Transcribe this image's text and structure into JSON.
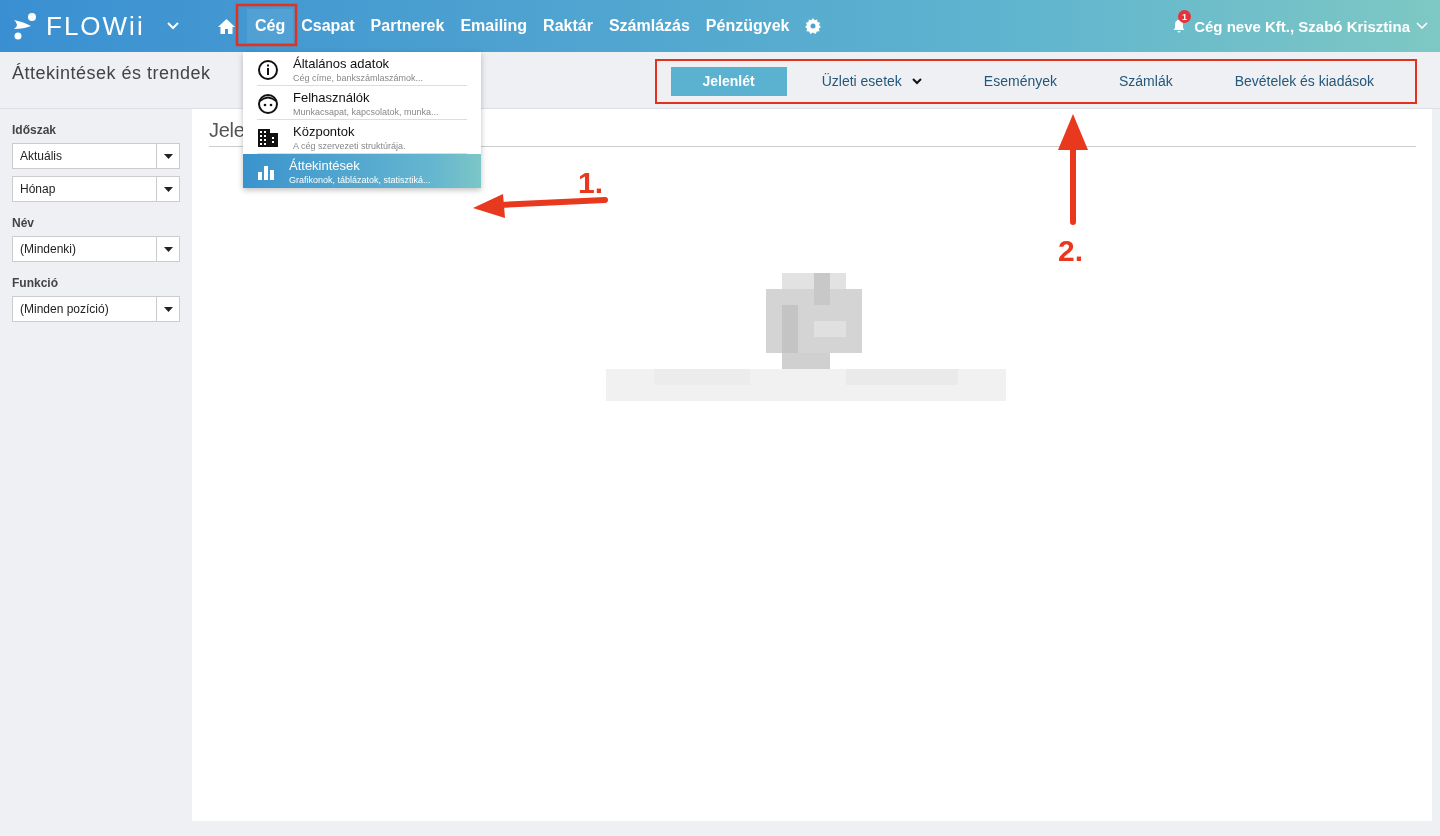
{
  "topbar": {
    "logo": "FLOWii",
    "nav": [
      {
        "label": "Cég",
        "selected": true
      },
      {
        "label": "Csapat",
        "selected": false
      },
      {
        "label": "Partnerek",
        "selected": false
      },
      {
        "label": "Emailing",
        "selected": false
      },
      {
        "label": "Raktár",
        "selected": false
      },
      {
        "label": "Számlázás",
        "selected": false
      },
      {
        "label": "Pénzügyek",
        "selected": false
      }
    ],
    "notification_count": "1",
    "user": "Cég neve Kft., Szabó Krisztina"
  },
  "page_title": "Áttekintések és trendek",
  "tabs": [
    {
      "label": "Jelenlét",
      "selected": true,
      "kind": "plain"
    },
    {
      "label": "Üzleti esetek",
      "selected": false,
      "kind": "dropdown"
    },
    {
      "label": "Események",
      "selected": false,
      "kind": "plain"
    },
    {
      "label": "Számlák",
      "selected": false,
      "kind": "plain"
    },
    {
      "label": "Bevételek és kiadások",
      "selected": false,
      "kind": "plain"
    }
  ],
  "filters": [
    {
      "label": "Időszak",
      "selects": [
        "Aktuális",
        "Hónap"
      ]
    },
    {
      "label": "Név",
      "selects": [
        "(Mindenki)"
      ]
    },
    {
      "label": "Funkció",
      "selects": [
        "(Minden pozíció)"
      ]
    }
  ],
  "content_heading": "Jele",
  "menu": [
    {
      "kind": "info",
      "title": "Általános adatok",
      "subtitle": "Cég címe, bankszámlaszámok...",
      "selected": false
    },
    {
      "kind": "users",
      "title": "Felhasználók",
      "subtitle": "Munkacsapat, kapcsolatok, munka...",
      "selected": false
    },
    {
      "kind": "building",
      "title": "Központok",
      "subtitle": "A cég szervezeti struktúrája.",
      "selected": false
    },
    {
      "kind": "chart",
      "title": "Áttekintések",
      "subtitle": "Grafikonok, táblázatok, statisztiká...",
      "selected": true
    }
  ],
  "annotations": [
    {
      "label": "1."
    },
    {
      "label": "2."
    }
  ]
}
